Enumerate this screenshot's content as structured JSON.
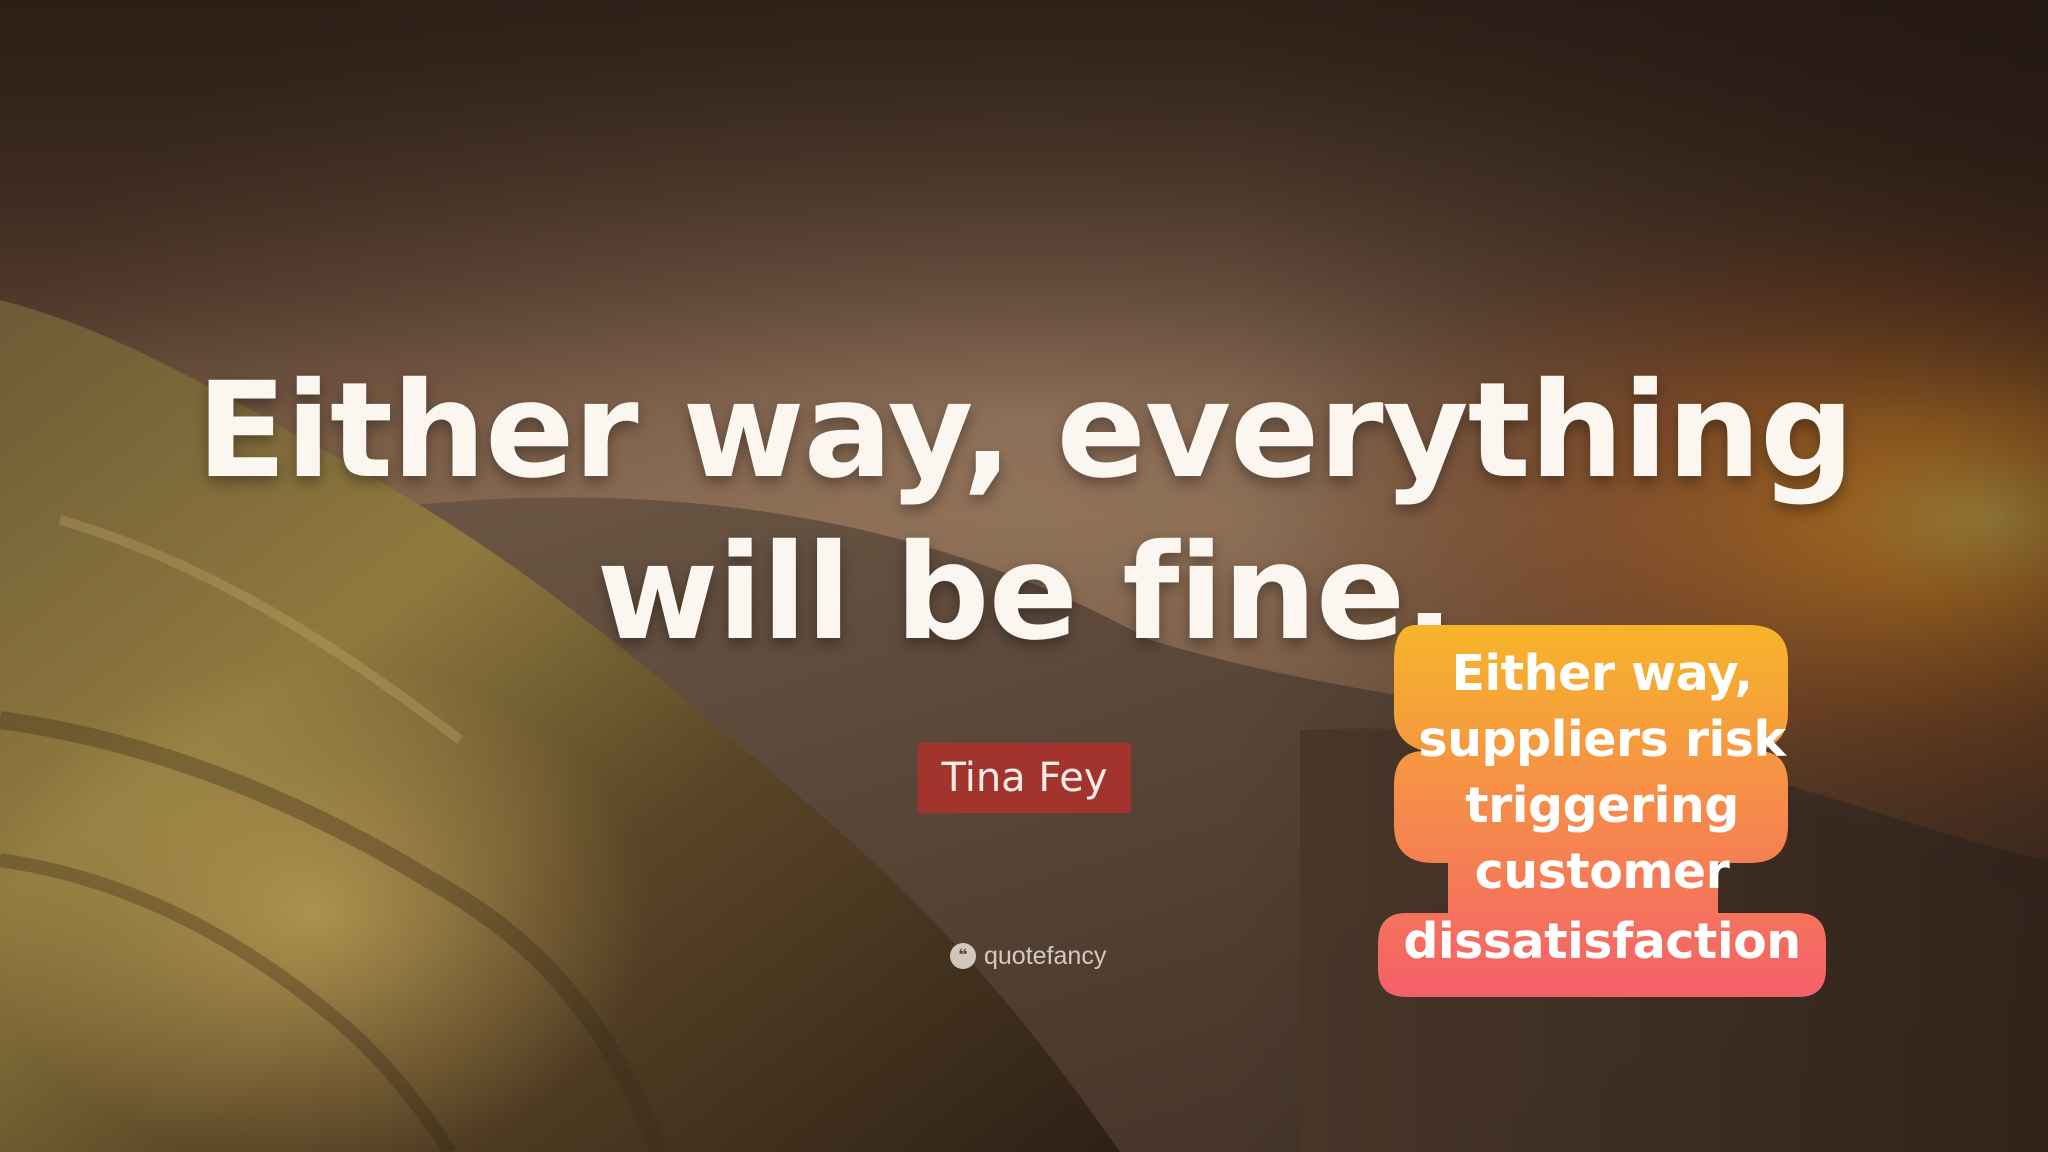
{
  "quote": {
    "line1": "Either way, everything",
    "line2": "will be fine."
  },
  "author": "Tina Fey",
  "watermark": "quotefancy",
  "sticker": {
    "lines": [
      "Either way,",
      "suppliers risk",
      "triggering",
      "customer",
      "dissatisfaction"
    ],
    "gradient_top": "#f7b52a",
    "gradient_bottom": "#f4606a"
  },
  "colors": {
    "quote_text": "#fbf6f0",
    "author_badge": "#ac322c",
    "sky_glow": "#f59a2a"
  }
}
